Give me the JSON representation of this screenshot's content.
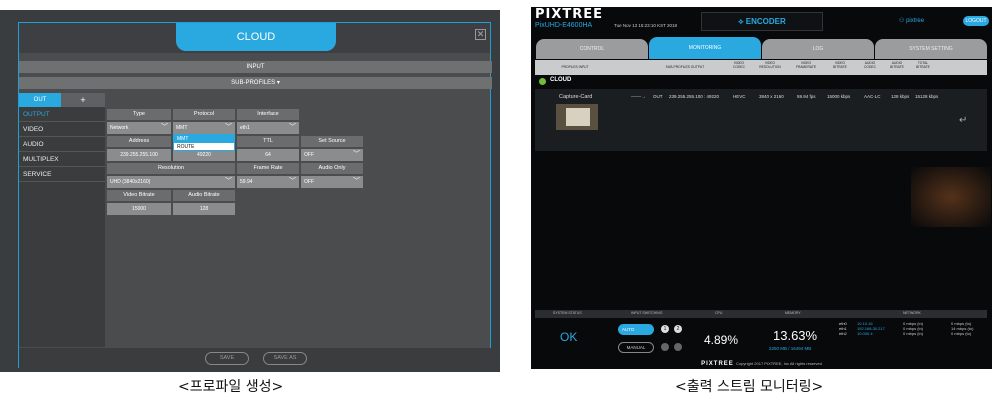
{
  "left": {
    "modal_title": "CLOUD",
    "input_bar": "INPUT",
    "sub_profiles_bar": "SUB-PROFILES",
    "tabs": {
      "out": "OUT",
      "plus": "+"
    },
    "sidebar": [
      "OUTPUT",
      "VIDEO",
      "AUDIO",
      "MULTIPLEX",
      "SERVICE"
    ],
    "fields": {
      "type": {
        "label": "Type",
        "value": "Network"
      },
      "protocol": {
        "label": "Protocol",
        "value": "MMT",
        "options": [
          "MMT",
          "ROUTE"
        ]
      },
      "interface": {
        "label": "Interface",
        "value": "eth1"
      },
      "address": {
        "label": "Address",
        "value": "239.255.255.100"
      },
      "port": {
        "value": "49220"
      },
      "ttl": {
        "label": "TTL",
        "value": "64"
      },
      "set_source": {
        "label": "Set Source",
        "value": "OFF"
      },
      "resolution": {
        "label": "Resolution",
        "value": "UHD (3840x2160)"
      },
      "frame_rate": {
        "label": "Frame Rate",
        "value": "59.94"
      },
      "audio_only": {
        "label": "Audio Only",
        "value": "OFF"
      },
      "video_bitrate": {
        "label": "Video Bitrate",
        "value": "15000"
      },
      "audio_bitrate": {
        "label": "Audio Bitrate",
        "value": "128"
      }
    },
    "footer": {
      "save": "SAVE",
      "save_as": "SAVE AS"
    },
    "caption": "<프로파일 생성>"
  },
  "right": {
    "logo": "PIXTREE",
    "model": "PixUHD-E4600HA",
    "datetime": "Tue Nov 13 15:23:10 KST 2018",
    "encoder": "ENCODER",
    "user": "pixtree",
    "logout": "LOGOUT",
    "tabs": [
      "CONTROL",
      "MONITORING",
      "LOG",
      "SYSTEM SETTING"
    ],
    "columns": [
      "PROFILES INPUT",
      "SUB-PROFILES OUTPUT",
      "VIDEO CODEC",
      "VIDEO RESOLUTION",
      "VIDEO FRAMERATE",
      "VIDEO BITRATE",
      "AUDIO CODEC",
      "AUDIO BITRATE",
      "TOTAL BITRATE"
    ],
    "cloud_label": "CLOUD",
    "stream": {
      "source": "Capture-Card",
      "out": "OUT",
      "address": "239.255.255.100 : 49220",
      "vcodec": "HEVC",
      "resolution": "3840 x 2160",
      "fps": "59.94 fps",
      "vbitrate": "15000 kbps",
      "acodec": "AAC-LC",
      "abitrate": "128 kbps",
      "total": "15128 kbps"
    },
    "status_heads": [
      "SYSTEM STATUS",
      "INPUT SWITCHING",
      "CPU",
      "MEMORY",
      "NETWORK"
    ],
    "system_status": "OK",
    "auto": "AUTO",
    "manual": "MANUAL",
    "cpu": "4.89%",
    "memory": "13.63%",
    "memory_detail": "2250 MB / 16494 MB",
    "network": {
      "ifaces": [
        "eth0",
        "eth1",
        "eth2"
      ],
      "ips": [
        "10.10.16",
        "192.168.30.217",
        "10.000.4"
      ],
      "in": [
        "0 mbps (in)",
        "0 mbps (in)",
        "0 mbps (in)"
      ],
      "out": [
        "0 mbps (to)",
        "14 mbps (to)",
        "0 mbps (to)"
      ]
    },
    "footer_logo": "PIXTREE",
    "footer_text": "Copyright 2017 PIXTREE, Inc All rights reserved",
    "caption": "<출력 스트림 모니터링>"
  }
}
